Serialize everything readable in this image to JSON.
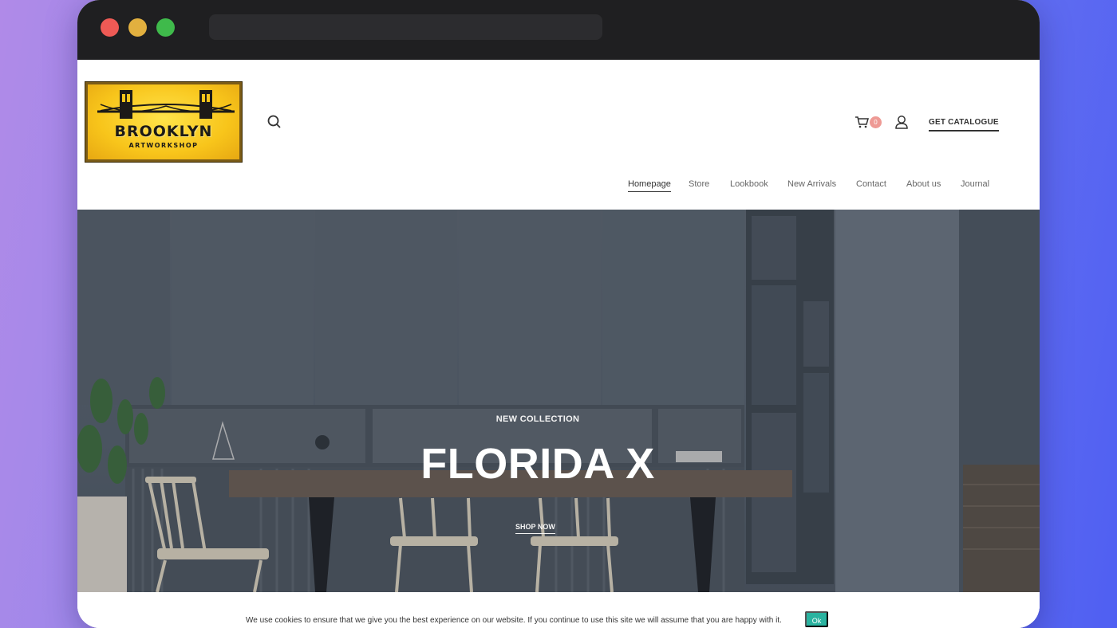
{
  "logo": {
    "title": "BROOKLYN",
    "subtitle": "ARTWORKSHOP"
  },
  "header": {
    "search_icon": "search-icon",
    "cart_icon": "cart-icon",
    "cart_count": "0",
    "user_icon": "user-icon",
    "catalogue_label": "GET CATALOGUE"
  },
  "nav": {
    "items": [
      {
        "label": "Homepage",
        "active": true
      },
      {
        "label": "Store"
      },
      {
        "label": "Lookbook"
      },
      {
        "label": "New Arrivals"
      },
      {
        "label": "Contact"
      },
      {
        "label": "About us"
      },
      {
        "label": "Journal"
      }
    ]
  },
  "hero": {
    "overline": "NEW COLLECTION",
    "title": "FLORIDA X",
    "cta": "SHOP NOW"
  },
  "cookie": {
    "text": "We use cookies to ensure that we give you the best experience on our website. If you continue to use this site we will assume that you are happy with it.",
    "ok_label": "Ok"
  },
  "colors": {
    "logo_yellow": "#f8c51b",
    "badge": "#ee9a95",
    "cookie_button": "#2ab3a0",
    "titlebar": "#1f1f21"
  }
}
